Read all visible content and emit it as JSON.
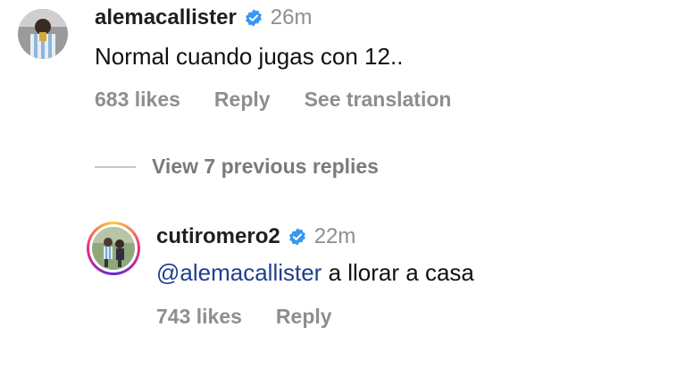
{
  "comment": {
    "username": "alemacallister",
    "time": "26m",
    "text": "Normal cuando jugas con 12..",
    "likes": "683 likes",
    "reply_label": "Reply",
    "translation_label": "See translation"
  },
  "view_replies": {
    "label": "View 7 previous replies"
  },
  "reply": {
    "username": "cutiromero2",
    "time": "22m",
    "mention": "@alemacallister",
    "text": " a llorar a casa",
    "likes": "743 likes",
    "reply_label": "Reply"
  },
  "colors": {
    "verified": "#3897f0",
    "meta_gray": "#8e8e8e",
    "mention": "#1f3f8f"
  },
  "icons": [
    "verified-badge-icon",
    "verified-badge-icon"
  ]
}
